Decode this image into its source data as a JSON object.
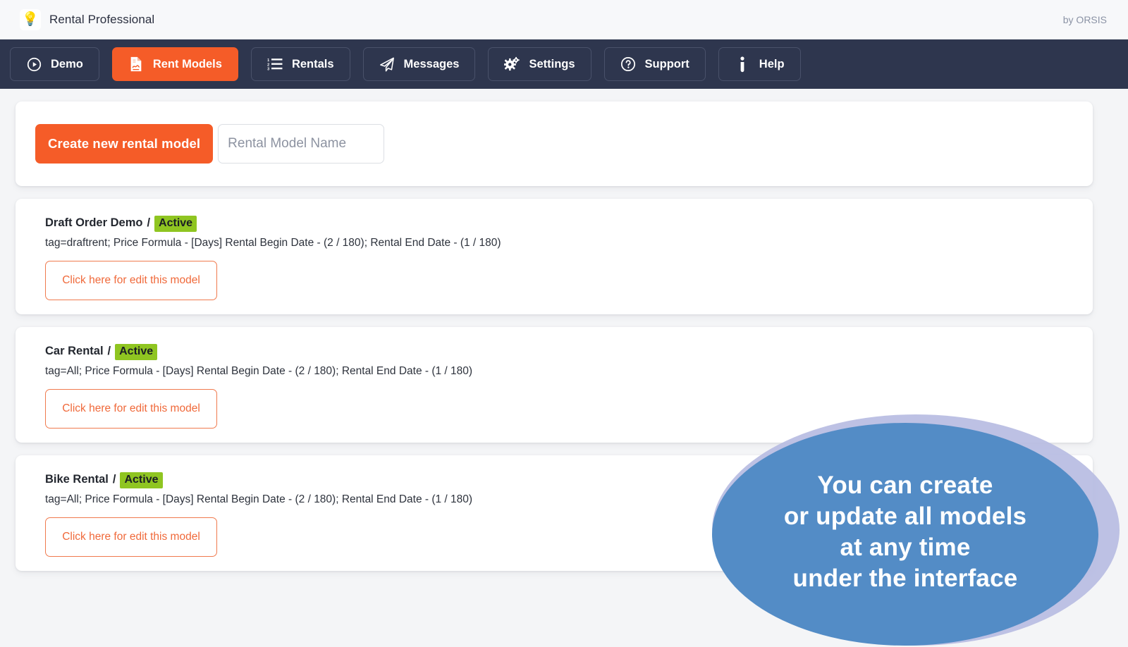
{
  "header": {
    "logo_icon": "lightbulb-idea-icon",
    "logo_glyph": "💡",
    "title": "Rental Professional",
    "byline": "by ORSIS"
  },
  "nav": {
    "items": [
      {
        "label": "Demo",
        "icon": "play-circle-icon",
        "active": false
      },
      {
        "label": "Rent Models",
        "icon": "document-signature-icon",
        "active": true
      },
      {
        "label": "Rentals",
        "icon": "numbered-list-icon",
        "active": false
      },
      {
        "label": "Messages",
        "icon": "paper-plane-icon",
        "active": false
      },
      {
        "label": "Settings",
        "icon": "gears-icon",
        "active": false
      },
      {
        "label": "Support",
        "icon": "question-circle-icon",
        "active": false
      },
      {
        "label": "Help",
        "icon": "info-icon",
        "active": false
      }
    ]
  },
  "create_panel": {
    "button_label": "Create new rental model",
    "input_value": "",
    "input_placeholder": "Rental Model Name"
  },
  "models": [
    {
      "name": "Draft Order Demo",
      "separator": "/",
      "status": "Active",
      "description": "tag=draftrent; Price Formula - [Days] Rental Begin Date - (2 / 180); Rental End Date - (1 / 180)",
      "edit_label": "Click here for edit this model"
    },
    {
      "name": "Car Rental",
      "separator": "/",
      "status": "Active",
      "description": "tag=All; Price Formula - [Days] Rental Begin Date - (2 / 180); Rental End Date - (1 / 180)",
      "edit_label": "Click here for edit this model"
    },
    {
      "name": "Bike Rental",
      "separator": "/",
      "status": "Active",
      "description": "tag=All; Price Formula - [Days] Rental Begin Date - (2 / 180); Rental End Date - (1 / 180)",
      "edit_label": "Click here for edit this model"
    }
  ],
  "callout": {
    "line1": "You can create",
    "line2": "or update all models",
    "line3": "at any time",
    "line4": "under the interface"
  },
  "colors": {
    "accent_orange": "#f55c28",
    "nav_background": "#2e364e",
    "page_background": "#f4f5f7",
    "status_green": "#8fc521",
    "callout_blue": "#538cc6",
    "callout_halo": "#b7bce2",
    "edit_border": "#f07a4e"
  }
}
